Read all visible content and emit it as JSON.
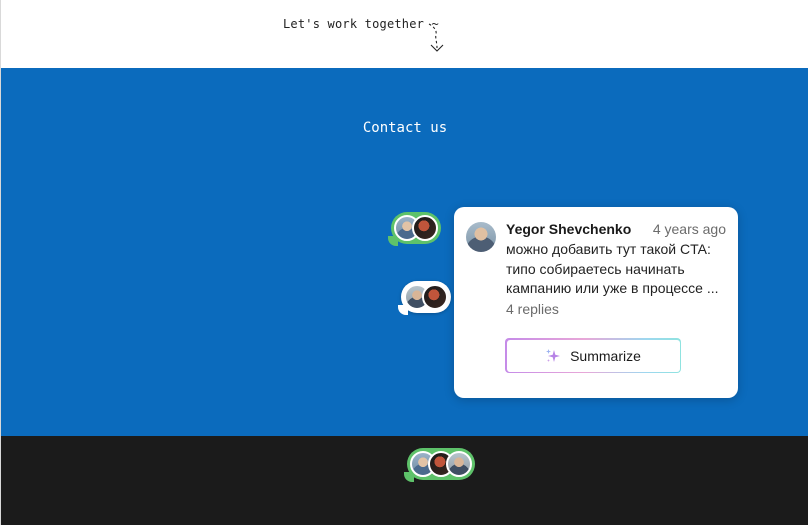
{
  "top": {
    "tagline": "Let's work together ~"
  },
  "contact": {
    "title": "Contact us"
  },
  "comment": {
    "author": "Yegor Shevchenko",
    "time": "4 years ago",
    "text": "можно добавить тут такой CTA: типо собираетесь начинать кампанию или уже в процессе ...",
    "replies": "4 replies",
    "summarize_label": "Summarize"
  },
  "colors": {
    "blue": "#0b6bbd",
    "dark": "#1b1b1b",
    "bubble_green": "#5ec26a"
  },
  "icons": {
    "arrow": "squiggle-down-arrow-icon",
    "sparkle": "sparkle-icon"
  }
}
